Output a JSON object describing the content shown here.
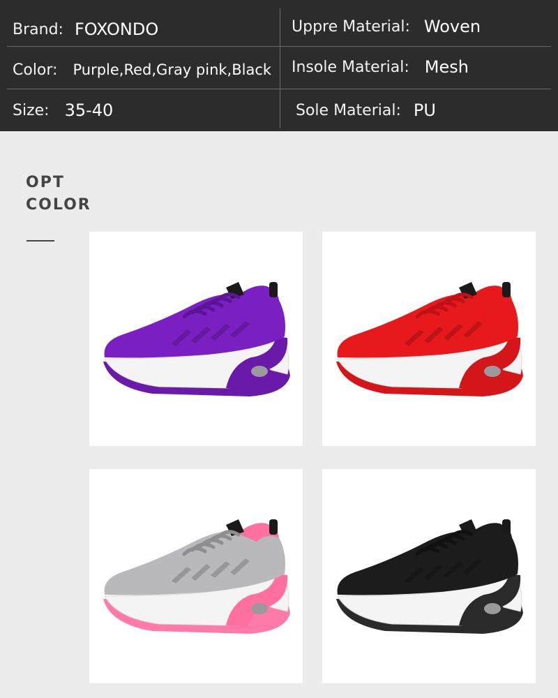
{
  "specs": {
    "brand_label": "Brand:",
    "brand_value": "FOXONDO",
    "upper_label": "Uppre Material:",
    "upper_value": "Woven",
    "color_label": "Color:",
    "color_value": "Purple,Red,Gray pink,Black",
    "insole_label": "Insole Material:",
    "insole_value": "Mesh",
    "size_label": "Size:",
    "size_value": "35-40",
    "sole_label": "Sole Material:",
    "sole_value": "PU"
  },
  "section": {
    "line1": "OPT",
    "line2": "COLOR"
  },
  "shoes": [
    {
      "color": "purple",
      "upper": "#7a1fc2",
      "accent": "#7a1fc2",
      "sole": "#6a1aa8",
      "lace": "#5c1496"
    },
    {
      "color": "red",
      "upper": "#e8191c",
      "accent": "#e8191c",
      "sole": "#d4161a",
      "lace": "#c01216"
    },
    {
      "color": "gray pink",
      "upper": "#b9b9bb",
      "accent": "#ff6fa0",
      "sole": "#ff7aa8",
      "lace": "#8e8e90"
    },
    {
      "color": "black",
      "upper": "#1c1c1c",
      "accent": "#1c1c1c",
      "sole": "#2a2a2a",
      "lace": "#111111"
    }
  ]
}
